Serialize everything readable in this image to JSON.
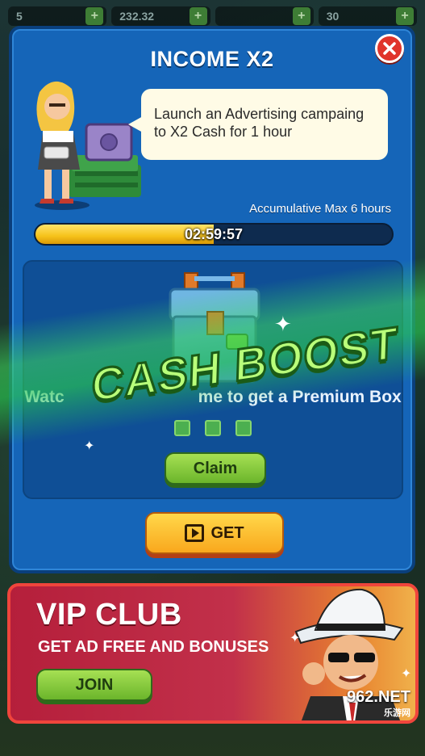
{
  "topbar": {
    "resources": [
      {
        "value": "5",
        "icon": "people-icon"
      },
      {
        "value": "232.32",
        "icon": "cash-icon"
      },
      {
        "value": "",
        "icon": "coin-icon"
      },
      {
        "value": "30",
        "icon": "gem-icon"
      }
    ]
  },
  "panel": {
    "title": "INCOME X2",
    "speech": "Launch an Advertising campaing to X2 Cash for 1 hour",
    "accumulative": "Accumulative Max 6 hours",
    "timer": "02:59:57",
    "progress_fraction": 0.5,
    "watch_text": "Watch ads 3 time to get a Premium Box",
    "watch_visible_left": "Watc",
    "watch_visible_right": "me to get a Premium Box",
    "claim_label": "Claim",
    "get_label": "GET",
    "boost_text": "CASH BOOST",
    "ad_dots": 3
  },
  "vip": {
    "title": "VIP CLUB",
    "subtitle": "GET AD FREE AND BONUSES",
    "join_label": "JOIN"
  },
  "watermark": {
    "main": "962.NET",
    "sub": "乐游网"
  },
  "colors": {
    "panel_blue": "#1565b8",
    "progress_yellow": "#f6c21a",
    "claim_green": "#6bb52b",
    "get_orange": "#f9a81d",
    "vip_red": "#c2304a",
    "close_red": "#e0342b"
  }
}
